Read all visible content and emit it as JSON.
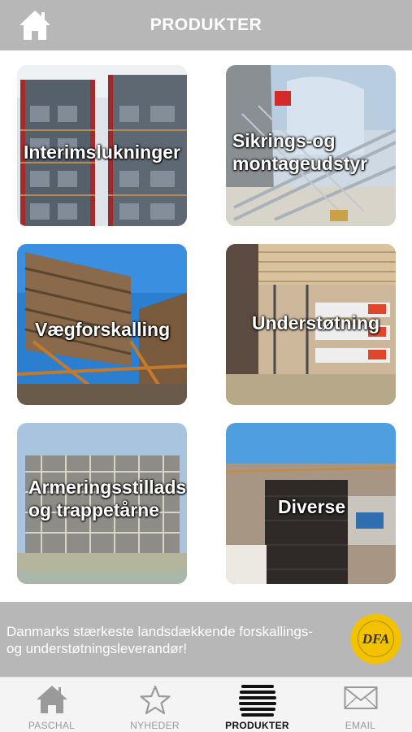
{
  "header": {
    "title": "PRODUKTER"
  },
  "tiles": [
    {
      "label": "Interimslukninger"
    },
    {
      "label": "Sikrings-og montageudstyr"
    },
    {
      "label": "Vægforskalling"
    },
    {
      "label": "Understøtning"
    },
    {
      "label": "Armeringsstillads og trappetårne"
    },
    {
      "label": "Diverse"
    }
  ],
  "banner": {
    "text": "Danmarks stærkeste landsdækkende forskallings- og understøtningsleverandør!",
    "badge_text": "DFA"
  },
  "tabbar": {
    "tabs": [
      {
        "label": "PASCHAL",
        "icon": "home-icon",
        "active": false
      },
      {
        "label": "NYHEDER",
        "icon": "star-icon",
        "active": false
      },
      {
        "label": "PRODUKTER",
        "icon": "stack-icon",
        "active": true
      },
      {
        "label": "EMAIL",
        "icon": "mail-icon",
        "active": false
      }
    ]
  },
  "colors": {
    "header_bg": "#b7b7b7",
    "banner_bg": "#b7b7b7",
    "tab_inactive": "#9a9a9a",
    "tab_active": "#111111"
  }
}
